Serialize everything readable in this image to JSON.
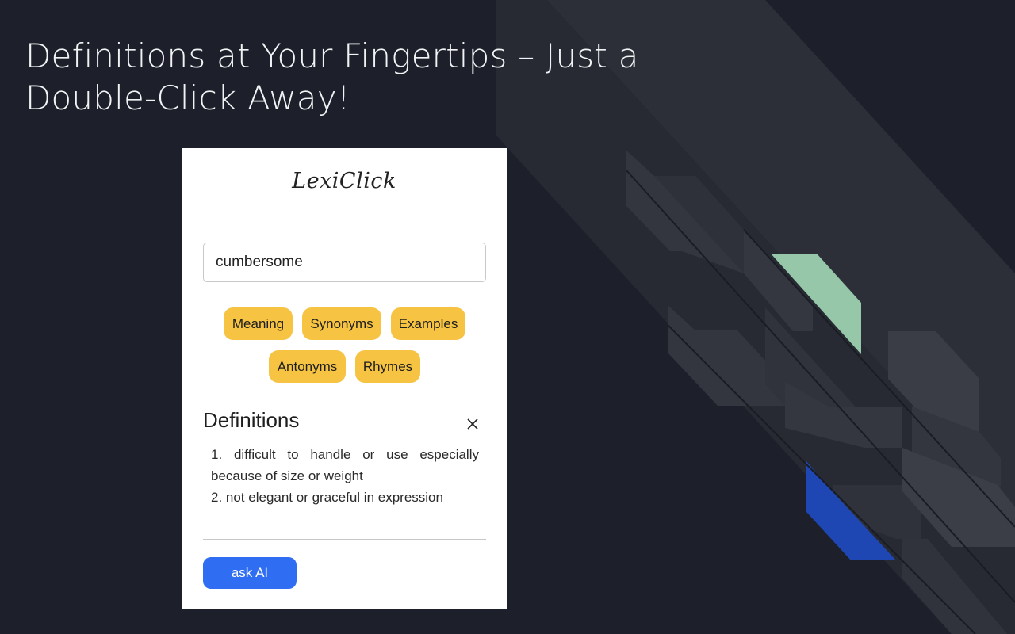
{
  "headline": {
    "line1": "Definitions at Your Fingertips – Just a",
    "line2": "Double-Click Away!"
  },
  "popup": {
    "app_name": "LexiClick",
    "search": {
      "value": "cumbersome",
      "placeholder": ""
    },
    "chips": [
      {
        "label": "Meaning"
      },
      {
        "label": "Synonyms"
      },
      {
        "label": "Examples"
      },
      {
        "label": "Antonyms"
      },
      {
        "label": "Rhymes"
      }
    ],
    "definitions": {
      "title": "Definitions",
      "items": [
        "1. difficult to handle or use especially because of size or weight",
        "2.  not elegant or graceful in expression"
      ]
    },
    "ask_ai_label": "ask AI"
  },
  "colors": {
    "background": "#1d202a",
    "chip": "#f6c343",
    "ask_button": "#2f6ef3",
    "accent_green": "#95c7a8",
    "accent_blue": "#1e47b4",
    "stripe": "#2d3039"
  }
}
